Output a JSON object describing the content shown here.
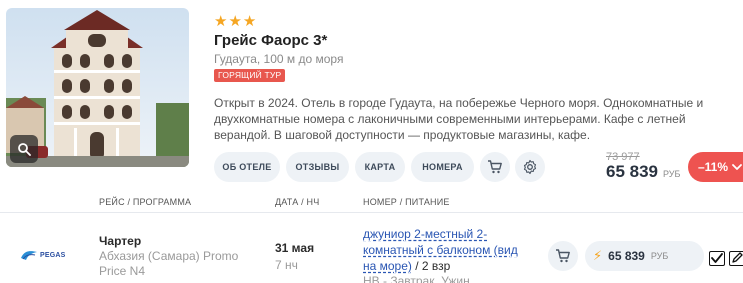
{
  "hotel": {
    "stars": 3,
    "name": "Грейс Фаорс 3*",
    "location": "Гудаута, 100 м до моря",
    "badge": "ГОРЯЩИЙ ТУР",
    "description": "Открыт в 2024. Отель в городе Гудаута, на побережье Черного моря. Однокомнатные и двухкомнатные номера с лаконичными современными интерьерами. Кафе с летней верандой. В шаговой доступности — продуктовые магазины, кафе."
  },
  "actions": {
    "about": "ОБ ОТЕЛЕ",
    "reviews": "ОТЗЫВЫ",
    "map": "КАРТА",
    "rooms": "НОМЕРА"
  },
  "pricing": {
    "old_price": "73 977",
    "price": "65 839",
    "currency": "РУБ",
    "discount": "–11%"
  },
  "table": {
    "headers": {
      "route": "РЕЙС / ПРОГРАММА",
      "date": "ДАТА / НЧ",
      "room": "НОМЕР / ПИТАНИЕ"
    },
    "row": {
      "operator_logo": "PEGAS",
      "tour_type": "Чартер",
      "route": "Абхазия (Самара) Promo Price N4",
      "date": "31 мая",
      "nights": "7 нч",
      "room_link": "джуниор 2-местный 2-комнатный с балконом (вид на море)",
      "room_guests": " / 2 взр",
      "meal": "НВ - Завтрак, Ужин",
      "price": "65 839",
      "currency": "РУБ"
    }
  },
  "colors": {
    "accent_red": "#ee5350",
    "star": "#f5a623",
    "link": "#2a56b3",
    "pill_bg": "#eef2f6"
  }
}
